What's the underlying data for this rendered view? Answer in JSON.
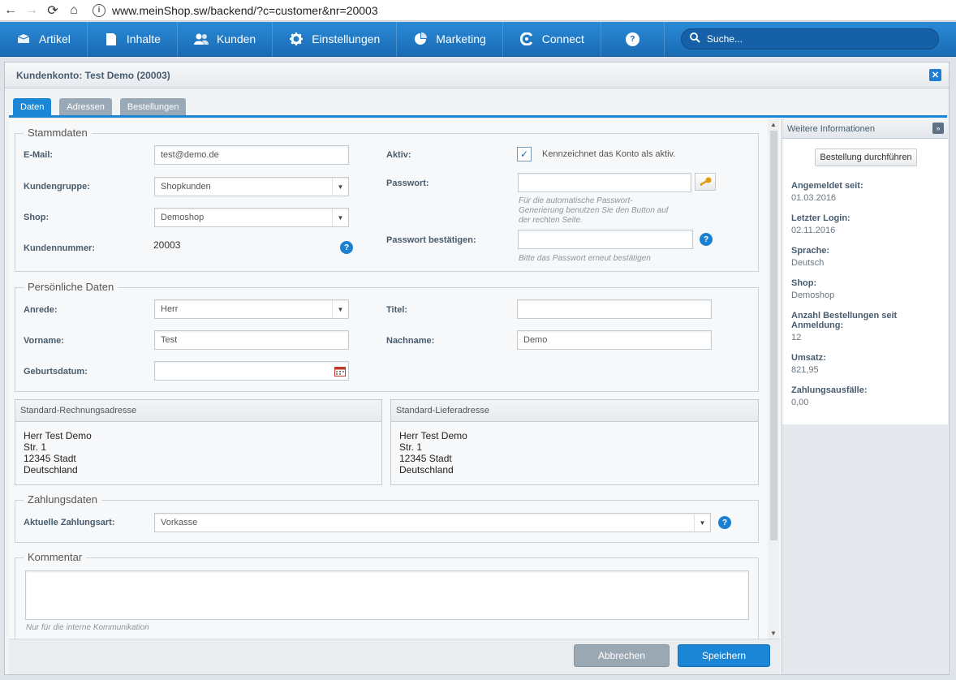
{
  "browser": {
    "back": "←",
    "forward": "→",
    "reload": "⟳",
    "home": "⌂",
    "info": "i",
    "url": "www.meinShop.sw/backend/?c=customer&nr=20003"
  },
  "menu": {
    "items": [
      {
        "label": "Artikel",
        "icon": "box-icon"
      },
      {
        "label": "Inhalte",
        "icon": "document-icon"
      },
      {
        "label": "Kunden",
        "icon": "users-icon"
      },
      {
        "label": "Einstellungen",
        "icon": "gear-icon"
      },
      {
        "label": "Marketing",
        "icon": "pie-chart-icon"
      },
      {
        "label": "Connect",
        "icon": "connect-icon"
      }
    ],
    "help": "?",
    "search_placeholder": "Suche..."
  },
  "window": {
    "title": "Kundenkonto: Test Demo (20003)",
    "close": "✕",
    "tabs": [
      "Daten",
      "Adressen",
      "Bestellungen"
    ]
  },
  "stammdaten": {
    "legend": "Stammdaten",
    "email_label": "E-Mail:",
    "email_value": "test@demo.de",
    "group_label": "Kundengruppe:",
    "group_value": "Shopkunden",
    "shop_label": "Shop:",
    "shop_value": "Demoshop",
    "number_label": "Kundennummer:",
    "number_value": "20003",
    "active_label": "Aktiv:",
    "active_text": "Kennzeichnet das Konto als aktiv.",
    "active_checked": "✓",
    "password_label": "Passwort:",
    "password_hint": "Für die automatische Passwort-\nGenerierung benutzen Sie den Button auf\nder rechten Seite.",
    "password_confirm_label": "Passwort bestätigen:",
    "password_confirm_hint": "Bitte das Passwort erneut bestätigen"
  },
  "personal": {
    "legend": "Persönliche Daten",
    "salutation_label": "Anrede:",
    "salutation_value": "Herr",
    "title_label": "Titel:",
    "title_value": "",
    "firstname_label": "Vorname:",
    "firstname_value": "Test",
    "lastname_label": "Nachname:",
    "lastname_value": "Demo",
    "birthday_label": "Geburtsdatum:",
    "birthday_value": ""
  },
  "billing": {
    "title": "Standard-Rechnungsadresse",
    "lines": [
      "Herr Test Demo",
      "Str. 1",
      "12345 Stadt",
      "Deutschland"
    ]
  },
  "shipping": {
    "title": "Standard-Lieferadresse",
    "lines": [
      "Herr Test Demo",
      "Str. 1",
      "12345 Stadt",
      "Deutschland"
    ]
  },
  "payment": {
    "legend": "Zahlungsdaten",
    "label": "Aktuelle Zahlungsart:",
    "value": "Vorkasse"
  },
  "comment": {
    "legend": "Kommentar",
    "hint": "Nur für die interne Kommunikation"
  },
  "buttons": {
    "cancel": "Abbrechen",
    "save": "Speichern"
  },
  "side": {
    "title": "Weitere Informationen",
    "collapse": "»",
    "order_button": "Bestellung durchführen",
    "items": [
      {
        "key": "Angemeldet seit:",
        "value": "01.03.2016"
      },
      {
        "key": "Letzter Login:",
        "value": "02.11.2016"
      },
      {
        "key": "Sprache:",
        "value": "Deutsch"
      },
      {
        "key": "Shop:",
        "value": "Demoshop"
      },
      {
        "key": "Anzahl Bestellungen seit Anmeldung:",
        "value": "12"
      },
      {
        "key": "Umsatz:",
        "value": "821,95"
      },
      {
        "key": "Zahlungsausfälle:",
        "value": "0,00"
      }
    ]
  }
}
